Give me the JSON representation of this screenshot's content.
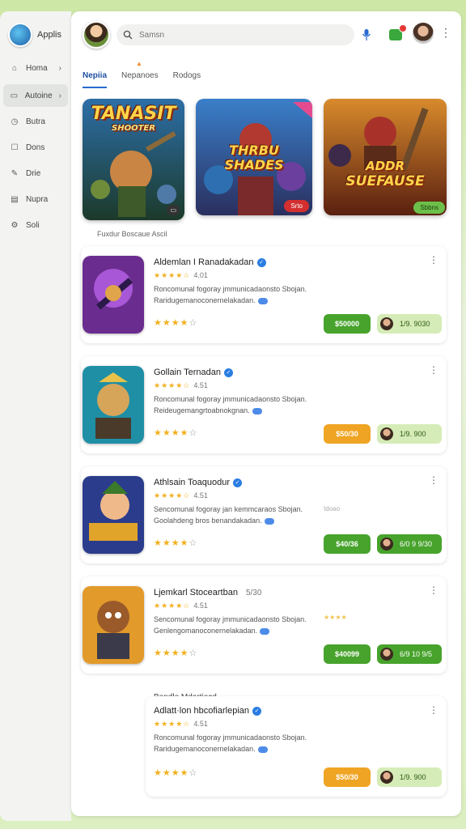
{
  "brand": {
    "name": "Applis"
  },
  "sidebar": {
    "items": [
      {
        "label": "Homa",
        "icon": "home-icon",
        "chevron": true
      },
      {
        "label": "Autoine",
        "icon": "apps-icon",
        "chevron": true
      },
      {
        "label": "Butra",
        "icon": "clock-icon",
        "chevron": false
      },
      {
        "label": "Dons",
        "icon": "box-icon",
        "chevron": false
      },
      {
        "label": "Drie",
        "icon": "edit-icon",
        "chevron": false
      },
      {
        "label": "Nupra",
        "icon": "book-icon",
        "chevron": false
      },
      {
        "label": "Soli",
        "icon": "settings-icon",
        "chevron": false
      }
    ]
  },
  "header": {
    "search_placeholder": "Samsn",
    "mic_icon": "mic-icon",
    "gift_icon": "gift-icon"
  },
  "tabs": [
    {
      "label": "Nepiia"
    },
    {
      "label": "Nepanoes"
    },
    {
      "label": "Rodogs"
    }
  ],
  "banners": [
    {
      "title_line1": "TANASIT",
      "title_line2": "SHOOTER",
      "badge": ""
    },
    {
      "title_line1": "THRBU",
      "title_line2": "SHADES",
      "badge": "Srto"
    },
    {
      "title_line1": "ADDR",
      "title_line2": "SUEFAUSE",
      "badge": "Sbbns"
    }
  ],
  "banner_caption": "Fuxdur Boscaue Ascil",
  "cards": [
    {
      "title": "Aldemlan I Ranadakadan",
      "rating_text": "4.01",
      "desc": "Roncomunal fogoray jmmunicadaonsto Sbojan. Raridugemanoconernelakadan.",
      "stars": 4,
      "price": "$50000",
      "get_label": "1/9. 9030",
      "price_color": "#47a32c",
      "get_color": "#d6ecb8",
      "side_note": ""
    },
    {
      "title": "Gollain Ternadan",
      "rating_text": "4.51",
      "desc": "Roncomunal fogoray jmmunicadaonsto Sbojan. Reideugemangrtoabnokgnan.",
      "stars": 4,
      "price": "$50/30",
      "get_label": "1/9. 900",
      "price_color": "#f0a423",
      "get_color": "#d6ecb8",
      "side_note": ""
    },
    {
      "title": "Athlsain Toaquodur",
      "rating_text": "4.51",
      "desc": "Sencomunal fogoray jan kemmcaraos Sbojan. Goolahdeng bros benandakadan.",
      "stars": 4,
      "price": "$40/36",
      "get_label": "6/0 9 9/30",
      "price_color": "#47a32c",
      "get_color": "#47a32c",
      "side_note": "Idoao"
    },
    {
      "title": "Ljemkarl Stoceartban",
      "rating_text": "4.51",
      "desc": "Sencomunal fogoray jmmunicadaonsto Sbojan. Genlengomanoconernelakadan.",
      "stars": 4,
      "price": "$40099",
      "get_label": "6/9 10 9/5",
      "price_color": "#47a32c",
      "get_color": "#47a32c",
      "side_note": "",
      "extra_badge": "5/30",
      "side_stars": "★★★★"
    },
    {
      "title": "Adlatt·lon hbcofiarlepian",
      "rating_text": "4.51",
      "desc": "Roncomunal fogoray jmmunicadaonsto Sbojan. Raridugemanoconernelakadan.",
      "stars": 4,
      "price": "$50/30",
      "get_label": "1/9. 900",
      "price_color": "#f0a423",
      "get_color": "#d6ecb8",
      "side_note": ""
    }
  ],
  "section_label": "Bendlo Mdartiecd"
}
